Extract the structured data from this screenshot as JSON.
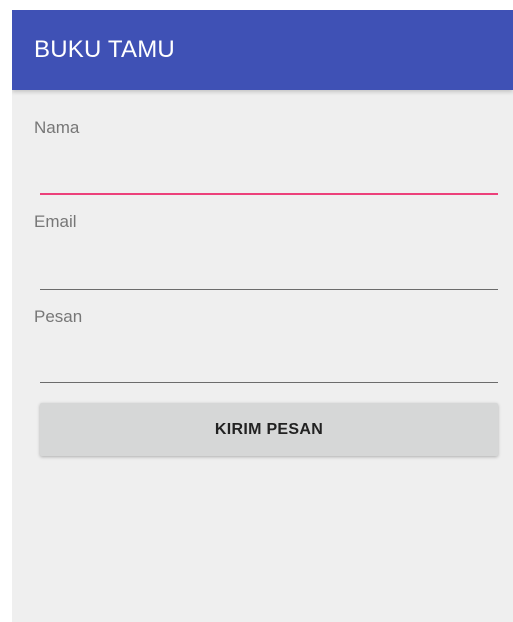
{
  "appbar": {
    "title": "BUKU TAMU"
  },
  "form": {
    "fields": [
      {
        "label": "Nama",
        "value": "",
        "placeholder": ""
      },
      {
        "label": "Email",
        "value": "",
        "placeholder": ""
      },
      {
        "label": "Pesan",
        "value": "",
        "placeholder": ""
      }
    ],
    "submit_label": "KIRIM PESAN"
  },
  "colors": {
    "appbar": "#3f51b5",
    "background": "#efefef",
    "accent": "#ec407a",
    "button": "#d6d7d7",
    "label": "#777777"
  }
}
